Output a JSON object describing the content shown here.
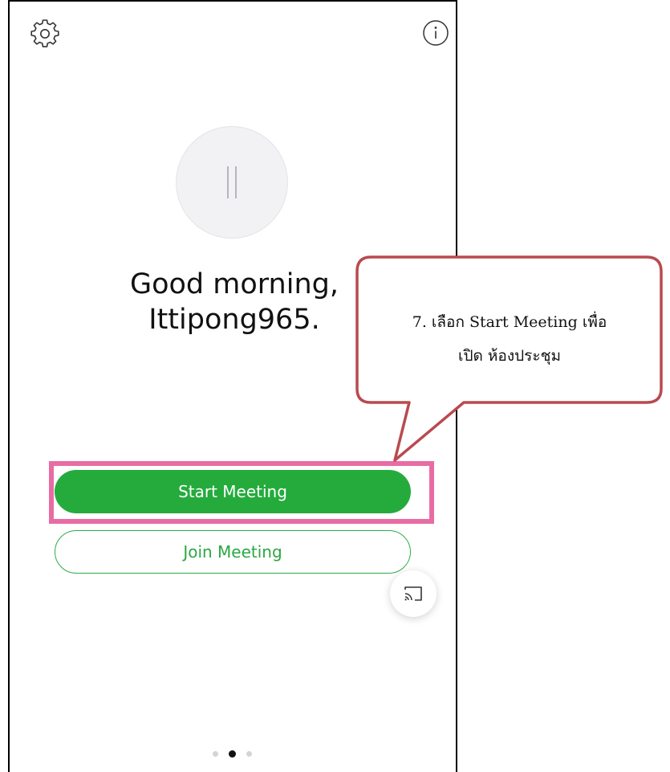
{
  "header": {
    "settings_icon": "gear-icon",
    "info_icon": "info-icon"
  },
  "greeting": {
    "line1": "Good morning,",
    "line2": "Ittipong965."
  },
  "buttons": {
    "start": "Start Meeting",
    "join": "Join Meeting"
  },
  "callout": {
    "line1": "7. เลือก Start Meeting เพื่อ",
    "line2": "เปิด ห้องประชุม"
  },
  "cast_icon": "cast-icon",
  "pagination": {
    "total": 3,
    "active": 2
  },
  "colors": {
    "accent_green": "#24ab3c",
    "highlight_pink": "#e86ca3",
    "callout_border": "#b94a4f"
  }
}
